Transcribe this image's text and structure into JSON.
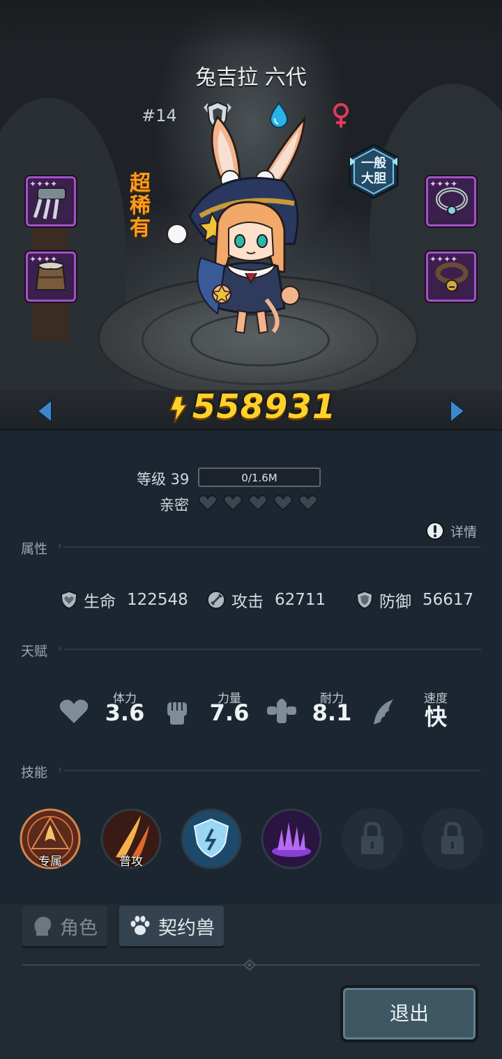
{
  "character": {
    "name": "兔吉拉 六代",
    "rank": "#14",
    "rarity": "超稀有",
    "trait": [
      "一般",
      "大胆"
    ],
    "power": "558931"
  },
  "level": {
    "label": "等级 39",
    "xp_text": "0/1.6M",
    "xp_fraction": 0
  },
  "intimacy": {
    "label": "亲密",
    "hearts_filled": 0,
    "hearts_total": 5
  },
  "details_label": "详情",
  "sections": {
    "attributes": "属性",
    "talents": "天赋",
    "skills": "技能"
  },
  "attributes": [
    {
      "icon": "shield-heart-icon",
      "label": "生命",
      "value": "122548"
    },
    {
      "icon": "sword-icon",
      "label": "攻击",
      "value": "62711"
    },
    {
      "icon": "shield-icon",
      "label": "防御",
      "value": "56617"
    }
  ],
  "talents": [
    {
      "icon": "heart-icon",
      "label": "体力",
      "value": "3.6"
    },
    {
      "icon": "fist-icon",
      "label": "力量",
      "value": "7.6"
    },
    {
      "icon": "muscle-icon",
      "label": "耐力",
      "value": "8.1"
    },
    {
      "icon": "wing-icon",
      "label": "速度",
      "value": "快"
    }
  ],
  "skills": [
    {
      "label": "专属",
      "locked": false
    },
    {
      "label": "普攻",
      "locked": false
    },
    {
      "label": "",
      "locked": false
    },
    {
      "label": "",
      "locked": false
    },
    {
      "label": "",
      "locked": true
    },
    {
      "label": "",
      "locked": true
    }
  ],
  "tabs": {
    "character": "角色",
    "pet": "契约兽"
  },
  "exit_label": "退出",
  "colors": {
    "rarity": "#ff9c1a",
    "power": "#ffd12b",
    "equip_border": "#a451c9",
    "background": "#1b2630"
  }
}
